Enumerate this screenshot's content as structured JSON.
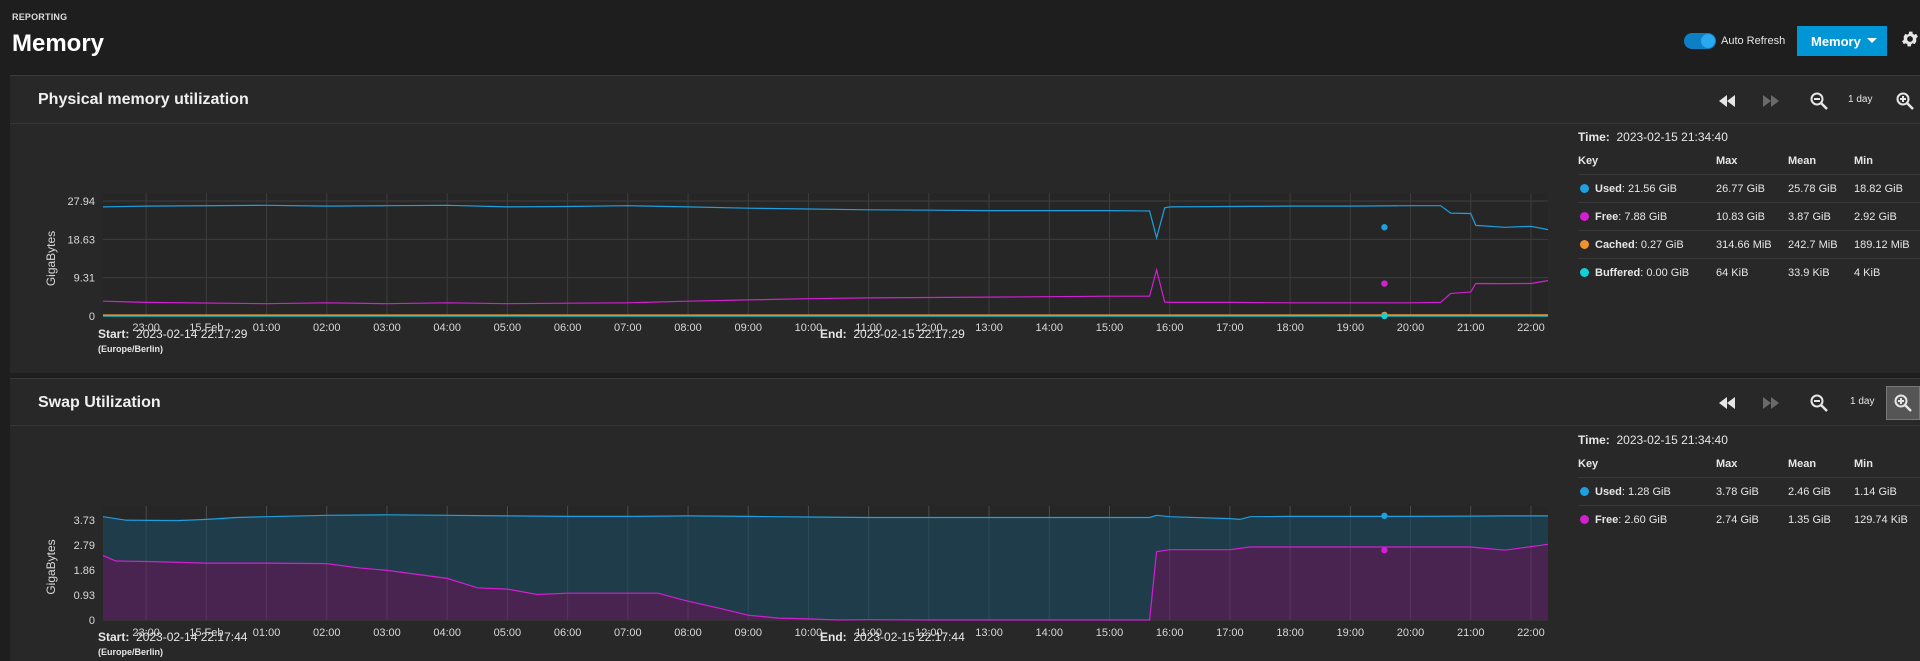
{
  "header": {
    "breadcrumb": "REPORTING",
    "title": "Memory",
    "auto_refresh_label": "Auto Refresh",
    "auto_refresh_on": true,
    "memory_button_label": "Memory"
  },
  "colors": {
    "accent": "#0095d5",
    "used": "#1d9fe0",
    "free": "#d31fd2",
    "cached": "#f0922e",
    "buffered": "#13d0d6"
  },
  "icons": [
    "rewind-icon",
    "fast-forward-icon",
    "zoom-out-icon",
    "zoom-in-icon",
    "gear-icon",
    "caret-down-icon"
  ],
  "physical": {
    "title": "Physical memory utilization",
    "zoom_label": "1 day",
    "start_label": "Start:",
    "start_value": "2023-02-14 22:17:29",
    "timezone": "(Europe/Berlin)",
    "end_label": "End:",
    "end_value": "2023-02-15 22:17:29",
    "legend": {
      "time_label": "Time:",
      "time_value": "2023-02-15 21:34:40",
      "headers": [
        "Key",
        "Max",
        "Mean",
        "Min"
      ],
      "rows": [
        {
          "name": "Used",
          "value": ": 21.56 GiB",
          "max": "26.77 GiB",
          "mean": "25.78 GiB",
          "min": "18.82 GiB",
          "color": "#1d9fe0"
        },
        {
          "name": "Free",
          "value": ": 7.88 GiB",
          "max": "10.83 GiB",
          "mean": "3.87 GiB",
          "min": "2.92 GiB",
          "color": "#d31fd2"
        },
        {
          "name": "Cached",
          "value": ": 0.27 GiB",
          "max": "314.66 MiB",
          "mean": "242.7 MiB",
          "min": "189.12 MiB",
          "color": "#f0922e"
        },
        {
          "name": "Buffered",
          "value": ": 0.00 GiB",
          "max": "64 KiB",
          "mean": "33.9 KiB",
          "min": "4 KiB",
          "color": "#13d0d6"
        }
      ]
    }
  },
  "swap": {
    "title": "Swap Utilization",
    "zoom_label": "1 day",
    "start_label": "Start:",
    "start_value": "2023-02-14 22:17:44",
    "timezone": "(Europe/Berlin)",
    "end_label": "End:",
    "end_value": "2023-02-15 22:17:44",
    "legend": {
      "time_label": "Time:",
      "time_value": "2023-02-15 21:34:40",
      "headers": [
        "Key",
        "Max",
        "Mean",
        "Min"
      ],
      "rows": [
        {
          "name": "Used",
          "value": ": 1.28 GiB",
          "max": "3.78 GiB",
          "mean": "2.46 GiB",
          "min": "1.14 GiB",
          "color": "#1d9fe0"
        },
        {
          "name": "Free",
          "value": ": 2.60 GiB",
          "max": "2.74 GiB",
          "mean": "1.35 GiB",
          "min": "129.74 KiB",
          "color": "#d31fd2"
        }
      ]
    }
  },
  "chart_data": [
    {
      "type": "line",
      "ylabel": "GigaBytes",
      "x_ticks": [
        "23:00",
        "15 Feb",
        "01:00",
        "02:00",
        "03:00",
        "04:00",
        "05:00",
        "06:00",
        "07:00",
        "08:00",
        "09:00",
        "10:00",
        "11:00",
        "12:00",
        "13:00",
        "14:00",
        "15:00",
        "16:00",
        "17:00",
        "18:00",
        "19:00",
        "20:00",
        "21:00",
        "22:00"
      ],
      "y_ticks": [
        "0",
        "9.31",
        "18.63",
        "27.94"
      ],
      "ylim": [
        0,
        27.94
      ],
      "series": [
        {
          "name": "Used",
          "color": "#1d9fe0",
          "points": [
            [
              "22:17",
              26.5
            ],
            [
              "23:00",
              26.7
            ],
            [
              "01:00",
              26.9
            ],
            [
              "02:00",
              26.7
            ],
            [
              "03:00",
              26.8
            ],
            [
              "04:00",
              26.9
            ],
            [
              "05:00",
              26.5
            ],
            [
              "06:00",
              26.6
            ],
            [
              "07:00",
              26.8
            ],
            [
              "08:00",
              26.5
            ],
            [
              "09:00",
              26.2
            ],
            [
              "10:00",
              26.0
            ],
            [
              "11:00",
              25.8
            ],
            [
              "12:00",
              25.7
            ],
            [
              "13:00",
              25.6
            ],
            [
              "14:00",
              25.6
            ],
            [
              "15:00",
              25.6
            ],
            [
              "15:40",
              25.5
            ],
            [
              "15:47",
              19.0
            ],
            [
              "15:55",
              26.3
            ],
            [
              "16:00",
              26.5
            ],
            [
              "17:00",
              26.6
            ],
            [
              "18:00",
              26.7
            ],
            [
              "19:00",
              26.7
            ],
            [
              "20:00",
              26.8
            ],
            [
              "20:30",
              26.8
            ],
            [
              "20:40",
              25.0
            ],
            [
              "21:00",
              24.9
            ],
            [
              "21:05",
              22.0
            ],
            [
              "21:34",
              21.56
            ],
            [
              "22:00",
              21.8
            ],
            [
              "22:17",
              21.0
            ]
          ]
        },
        {
          "name": "Free",
          "color": "#d31fd2",
          "points": [
            [
              "22:17",
              3.6
            ],
            [
              "23:00",
              3.3
            ],
            [
              "01:00",
              3.0
            ],
            [
              "02:00",
              3.2
            ],
            [
              "03:00",
              3.0
            ],
            [
              "04:00",
              3.2
            ],
            [
              "05:00",
              3.0
            ],
            [
              "06:00",
              3.1
            ],
            [
              "07:00",
              3.2
            ],
            [
              "08:00",
              3.6
            ],
            [
              "09:00",
              3.9
            ],
            [
              "10:00",
              4.2
            ],
            [
              "11:00",
              4.4
            ],
            [
              "12:00",
              4.5
            ],
            [
              "13:00",
              4.6
            ],
            [
              "14:00",
              4.7
            ],
            [
              "15:00",
              4.8
            ],
            [
              "15:40",
              4.8
            ],
            [
              "15:47",
              11.2
            ],
            [
              "15:55",
              3.4
            ],
            [
              "16:00",
              3.3
            ],
            [
              "17:00",
              3.3
            ],
            [
              "18:00",
              3.2
            ],
            [
              "19:00",
              3.2
            ],
            [
              "20:00",
              3.2
            ],
            [
              "20:30",
              3.3
            ],
            [
              "20:40",
              5.5
            ],
            [
              "21:00",
              5.8
            ],
            [
              "21:05",
              7.9
            ],
            [
              "21:34",
              7.88
            ],
            [
              "22:00",
              7.9
            ],
            [
              "22:17",
              8.6
            ]
          ]
        },
        {
          "name": "Cached",
          "color": "#f0922e",
          "points": [
            [
              "22:17",
              0.25
            ],
            [
              "21:34",
              0.27
            ],
            [
              "22:17",
              0.26
            ]
          ]
        },
        {
          "name": "Buffered",
          "color": "#13d0d6",
          "points": [
            [
              "22:17",
              0
            ],
            [
              "21:34",
              0
            ],
            [
              "22:17",
              0
            ]
          ]
        }
      ]
    },
    {
      "type": "area",
      "ylabel": "GigaBytes",
      "x_ticks": [
        "23:00",
        "15 Feb",
        "01:00",
        "02:00",
        "03:00",
        "04:00",
        "05:00",
        "06:00",
        "07:00",
        "08:00",
        "09:00",
        "10:00",
        "11:00",
        "12:00",
        "13:00",
        "14:00",
        "15:00",
        "16:00",
        "17:00",
        "18:00",
        "19:00",
        "20:00",
        "21:00",
        "22:00"
      ],
      "y_ticks": [
        "0",
        "0.93",
        "1.86",
        "2.79",
        "3.73"
      ],
      "ylim": [
        0,
        3.95
      ],
      "series": [
        {
          "name": "Used",
          "color": "#1d9fe0",
          "points": [
            [
              "22:17",
              3.85
            ],
            [
              "22:40",
              3.72
            ],
            [
              "23:30",
              3.7
            ],
            [
              "00:00",
              3.75
            ],
            [
              "00:30",
              3.82
            ],
            [
              "01:00",
              3.85
            ],
            [
              "02:00",
              3.9
            ],
            [
              "03:00",
              3.92
            ],
            [
              "04:00",
              3.9
            ],
            [
              "05:00",
              3.88
            ],
            [
              "06:00",
              3.86
            ],
            [
              "07:00",
              3.86
            ],
            [
              "08:00",
              3.88
            ],
            [
              "09:00",
              3.86
            ],
            [
              "10:00",
              3.84
            ],
            [
              "11:00",
              3.82
            ],
            [
              "12:00",
              3.82
            ],
            [
              "13:00",
              3.82
            ],
            [
              "14:00",
              3.82
            ],
            [
              "15:00",
              3.82
            ],
            [
              "15:40",
              3.82
            ],
            [
              "15:47",
              3.9
            ],
            [
              "16:00",
              3.85
            ],
            [
              "17:00",
              3.78
            ],
            [
              "17:10",
              3.75
            ],
            [
              "17:20",
              3.85
            ],
            [
              "18:00",
              3.86
            ],
            [
              "19:00",
              3.86
            ],
            [
              "20:00",
              3.86
            ],
            [
              "21:00",
              3.87
            ],
            [
              "21:34",
              3.88
            ],
            [
              "22:17",
              3.88
            ]
          ]
        },
        {
          "name": "Free",
          "color": "#d31fd2",
          "points": [
            [
              "22:17",
              2.4
            ],
            [
              "22:30",
              2.2
            ],
            [
              "23:00",
              2.18
            ],
            [
              "00:00",
              2.12
            ],
            [
              "01:00",
              2.12
            ],
            [
              "02:00",
              2.1
            ],
            [
              "02:30",
              1.95
            ],
            [
              "03:00",
              1.85
            ],
            [
              "04:00",
              1.55
            ],
            [
              "04:30",
              1.2
            ],
            [
              "05:00",
              1.15
            ],
            [
              "05:30",
              0.95
            ],
            [
              "06:00",
              1.0
            ],
            [
              "07:00",
              1.0
            ],
            [
              "07:30",
              1.0
            ],
            [
              "08:00",
              0.7
            ],
            [
              "08:30",
              0.45
            ],
            [
              "09:00",
              0.18
            ],
            [
              "09:30",
              0.07
            ],
            [
              "10:00",
              0.04
            ],
            [
              "10:30",
              0.0
            ],
            [
              "11:00",
              0.01
            ],
            [
              "12:00",
              0.0
            ],
            [
              "13:00",
              0.0
            ],
            [
              "14:00",
              0.0
            ],
            [
              "15:00",
              0.0
            ],
            [
              "15:40",
              0.0
            ],
            [
              "15:47",
              2.55
            ],
            [
              "16:00",
              2.62
            ],
            [
              "17:00",
              2.62
            ],
            [
              "17:20",
              2.72
            ],
            [
              "18:00",
              2.72
            ],
            [
              "19:00",
              2.72
            ],
            [
              "20:00",
              2.72
            ],
            [
              "21:00",
              2.72
            ],
            [
              "21:34",
              2.6
            ],
            [
              "22:17",
              2.82
            ]
          ]
        }
      ]
    }
  ]
}
